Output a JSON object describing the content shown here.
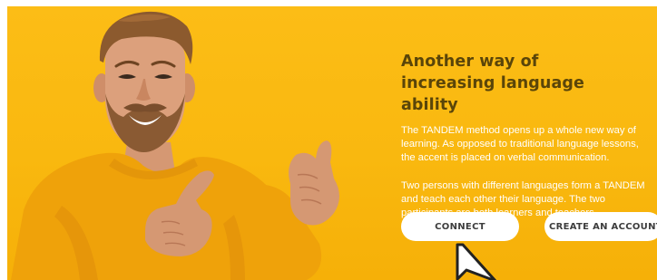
{
  "headline": "Another way of increasing language ability",
  "paragraphs": {
    "intro_lines": [
      "The TANDEM method opens up a whole new way of",
      "learning. As opposed to traditional language lessons,",
      "the accent is placed on verbal communication."
    ],
    "detail_lines": [
      "Two persons with different languages form a TANDEM",
      "and teach each other their language. The two",
      "participants are both learners and teachers."
    ]
  },
  "buttons": {
    "connect": "CONNECT",
    "create_account": "CREATE AN ACCOUNT"
  },
  "colors": {
    "banner": "#f9b80f",
    "headline": "#5a4509",
    "body_text": "#ffffff",
    "button_bg": "#ffffff",
    "button_text": "#3d3d3d",
    "sweater": "#efa20a"
  },
  "icons": {
    "cursor": "mouse-pointer-icon"
  }
}
